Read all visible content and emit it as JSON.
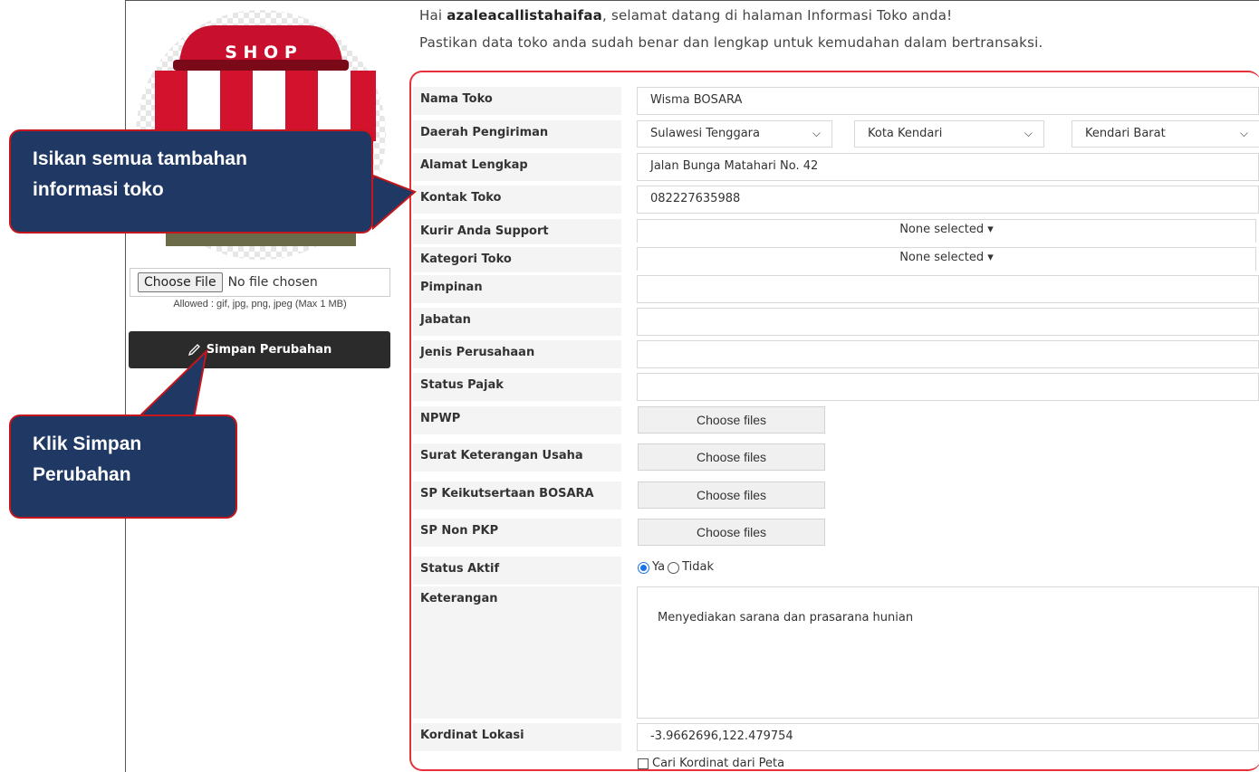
{
  "greeting": {
    "prefix": "Hai ",
    "username": "azaleacallistahaifaa",
    "suffix": ", selamat datang di halaman Informasi Toko anda!",
    "line2": "Pastikan data toko anda sudah benar dan lengkap untuk kemudahan dalam bertransaksi."
  },
  "sidebar": {
    "logo_text": "S H O P",
    "file_button": "Choose File",
    "file_status": "No file chosen",
    "allowed": "Allowed : gif, jpg, png, jpeg (Max 1 MB)",
    "save_label": "Simpan Perubahan"
  },
  "form": {
    "nama_toko": {
      "label": "Nama Toko",
      "value": "Wisma BOSARA"
    },
    "daerah": {
      "label": "Daerah Pengiriman",
      "province": "Sulawesi Tenggara",
      "city": "Kota Kendari",
      "district": "Kendari Barat"
    },
    "alamat": {
      "label": "Alamat Lengkap",
      "value": "Jalan Bunga Matahari No. 42"
    },
    "kontak": {
      "label": "Kontak Toko",
      "value": "082227635988"
    },
    "kurir": {
      "label": "Kurir Anda Support",
      "value": "None selected ▾"
    },
    "kategori": {
      "label": "Kategori Toko",
      "value": "None selected ▾"
    },
    "pimpinan": {
      "label": "Pimpinan",
      "value": ""
    },
    "jabatan": {
      "label": "Jabatan",
      "value": ""
    },
    "jenis": {
      "label": "Jenis Perusahaan",
      "value": ""
    },
    "pajak": {
      "label": "Status Pajak",
      "value": ""
    },
    "npwp": {
      "label": "NPWP",
      "button": "Choose files"
    },
    "sku": {
      "label": "Surat Keterangan Usaha",
      "button": "Choose files"
    },
    "sp_bosara": {
      "label": "SP Keikutsertaan BOSARA",
      "button": "Choose files"
    },
    "sp_pkp": {
      "label": "SP Non PKP",
      "button": "Choose files"
    },
    "status_aktif": {
      "label": "Status Aktif",
      "opt_yes": "Ya",
      "opt_no": "Tidak",
      "selected": "Ya"
    },
    "keterangan": {
      "label": "Keterangan",
      "value": "Menyediakan sarana dan prasarana hunian"
    },
    "kordinat": {
      "label": "Kordinat Lokasi",
      "value": "-3.9662696,122.479754",
      "checkbox_label": "Cari Kordinat dari Peta"
    }
  },
  "callouts": {
    "info": {
      "line1": "Isikan semua tambahan",
      "line2": "informasi toko"
    },
    "save": {
      "line1": "Klik Simpan",
      "line2": "Perubahan"
    }
  },
  "colors": {
    "callout_bg": "#1f3864",
    "callout_border": "#c4161c",
    "highlight": "#e8303a",
    "save_button": "#2b2b2b"
  }
}
